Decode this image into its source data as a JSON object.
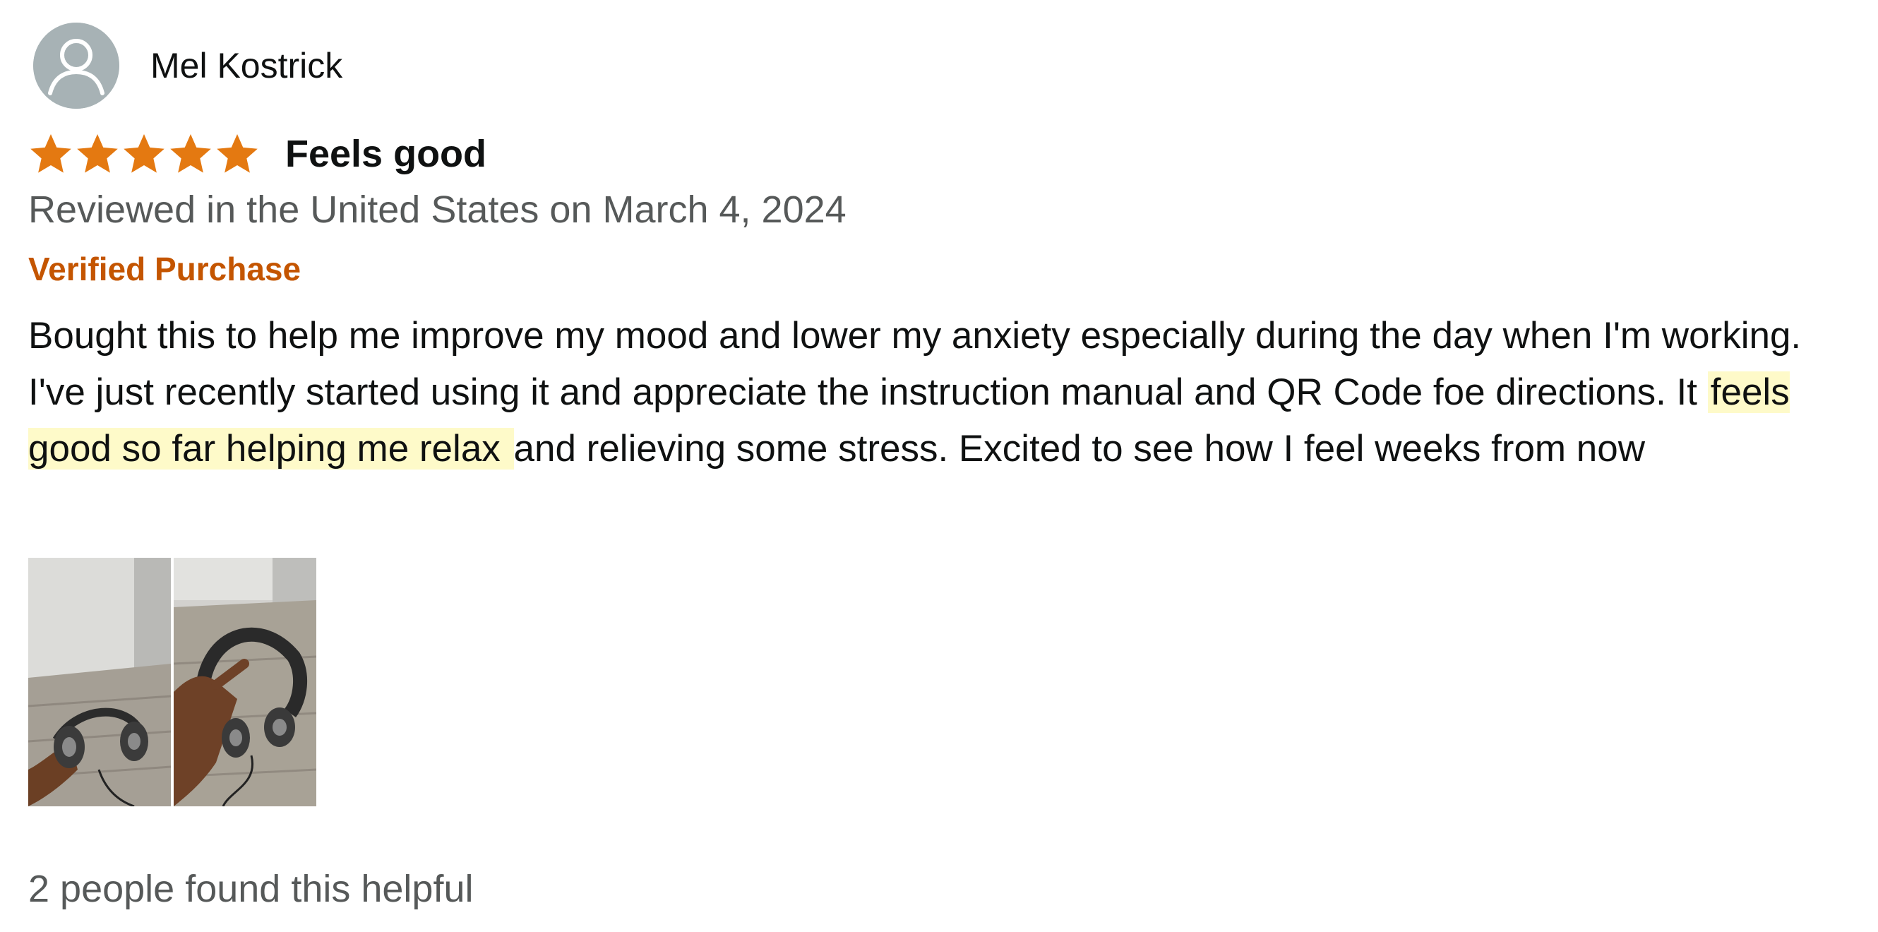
{
  "review": {
    "reviewer_name": "Mel Kostrick",
    "avatar_icon": "default-user-avatar-icon",
    "rating": 5,
    "rating_max": 5,
    "star_color": "#e47911",
    "title": "Feels good",
    "date_text": "Reviewed in the United States on March 4, 2024",
    "verified_label": "Verified Purchase",
    "verified_color": "#c45500",
    "body_before_highlight": "Bought this to help me improve my mood and lower my anxiety especially during the day when I'm working. I've just recently started using it and appreciate the instruction manual and QR Code foe directions. It ",
    "body_highlight": "feels good so far helping me relax ",
    "body_after_highlight": "and relieving some stress. Excited to see how I feel weeks from now",
    "highlight_color": "#fefac9",
    "images": [
      {
        "subject": "hand holding headphones on wooden floor"
      },
      {
        "subject": "hand holding headphones upright"
      }
    ],
    "helpful_text": "2 people found this helpful"
  }
}
